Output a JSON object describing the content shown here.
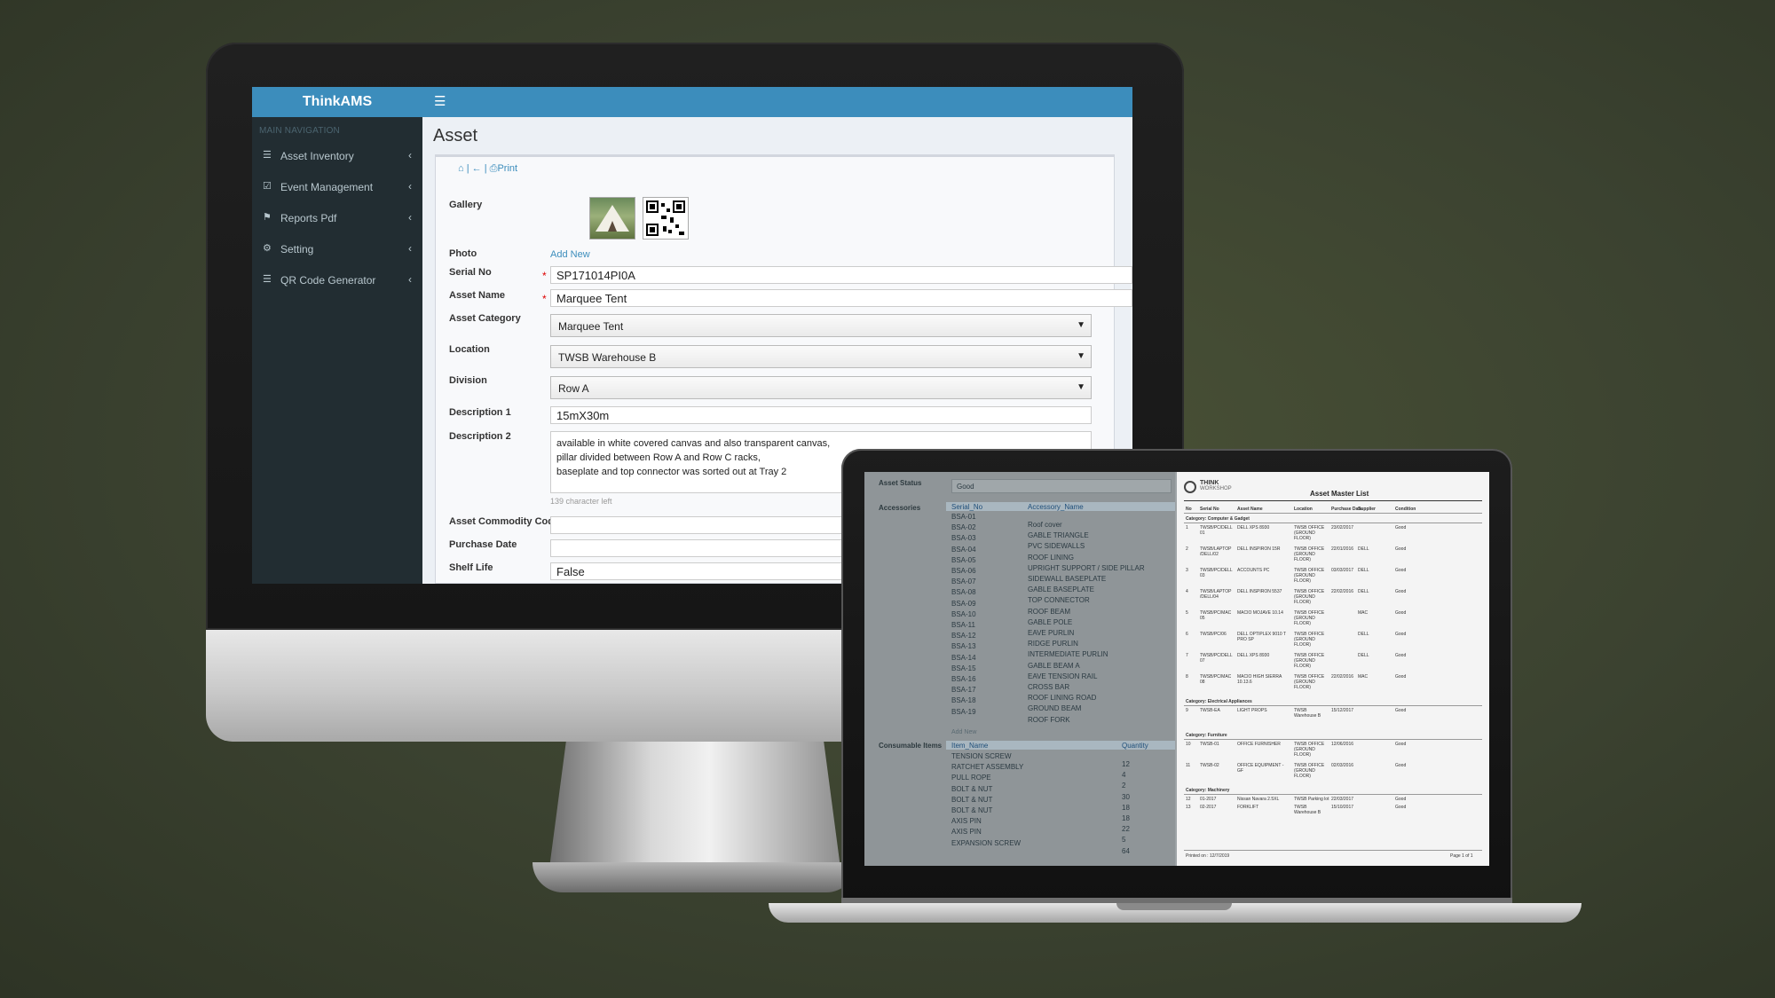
{
  "app": {
    "brand": "ThinkAMS",
    "menu_icon": "hamburger-icon"
  },
  "sidebar": {
    "header": "MAIN NAVIGATION",
    "items": [
      {
        "label": "Asset Inventory",
        "icon": "list-icon"
      },
      {
        "label": "Event Management",
        "icon": "check-square-icon"
      },
      {
        "label": "Reports Pdf",
        "icon": "flag-icon"
      },
      {
        "label": "Setting",
        "icon": "gears-icon"
      },
      {
        "label": "QR Code Generator",
        "icon": "list-icon"
      }
    ]
  },
  "asset_form": {
    "title": "Asset",
    "toolbar": {
      "print": "Print"
    },
    "labels": {
      "gallery": "Gallery",
      "photo": "Photo",
      "serial": "Serial No",
      "name": "Asset Name",
      "category": "Asset Category",
      "location": "Location",
      "division": "Division",
      "desc1": "Description 1",
      "desc2": "Description 2",
      "commodity": "Asset Commodity Code",
      "purchase": "Purchase Date",
      "shelf": "Shelf Life"
    },
    "add_new": "Add New",
    "values": {
      "serial": "SP171014PI0A",
      "name": "Marquee Tent",
      "category": "Marquee Tent",
      "location": "TWSB Warehouse B",
      "division": "Row A",
      "desc1": "15mX30m",
      "desc2_lines": [
        "available in white covered canvas and also transparent canvas,",
        "pillar divided between Row A and Row C racks,",
        "baseplate and top connector was sorted out at Tray 2"
      ],
      "char_left": "139 character left",
      "shelf": "False"
    }
  },
  "laptop": {
    "asset_status_label": "Asset Status",
    "asset_status_value": "Good",
    "accessories_label": "Accessories",
    "acc_headers": [
      "Serial_No",
      "Accessory_Name"
    ],
    "accessories": [
      [
        "BSA-01",
        "Roof cover"
      ],
      [
        "BSA-02",
        "GABLE TRIANGLE"
      ],
      [
        "BSA-03",
        "PVC SIDEWALLS"
      ],
      [
        "BSA-04",
        "ROOF LINING"
      ],
      [
        "BSA-05",
        "UPRIGHT SUPPORT / SIDE PILLAR"
      ],
      [
        "BSA-06",
        "SIDEWALL BASEPLATE"
      ],
      [
        "BSA-07",
        "GABLE BASEPLATE"
      ],
      [
        "BSA-08",
        "TOP CONNECTOR"
      ],
      [
        "BSA-09",
        "ROOF BEAM"
      ],
      [
        "BSA-10",
        "GABLE POLE"
      ],
      [
        "BSA-11",
        "EAVE PURLIN"
      ],
      [
        "BSA-12",
        "RIDGE PURLIN"
      ],
      [
        "BSA-13",
        "INTERMEDIATE PURLIN"
      ],
      [
        "BSA-14",
        "GABLE BEAM A"
      ],
      [
        "BSA-15",
        "EAVE TENSION RAIL"
      ],
      [
        "BSA-16",
        "CROSS BAR"
      ],
      [
        "BSA-17",
        "ROOF LINING ROAD"
      ],
      [
        "BSA-18",
        "GROUND BEAM"
      ],
      [
        "BSA-19",
        "ROOF FORK"
      ]
    ],
    "acc_add_new": "Add New",
    "consumables_label": "Consumable Items",
    "cons_headers": [
      "Item_Name",
      "Quantity"
    ],
    "consumables": [
      [
        "TENSION SCREW",
        "12"
      ],
      [
        "RATCHET ASSEMBLY",
        "4"
      ],
      [
        "PULL ROPE",
        "2"
      ],
      [
        "BOLT & NUT",
        "30"
      ],
      [
        "BOLT & NUT",
        "18"
      ],
      [
        "BOLT & NUT",
        "18"
      ],
      [
        "AXIS PIN",
        "22"
      ],
      [
        "AXIS PIN",
        "5"
      ],
      [
        "EXPANSION SCREW",
        "64"
      ]
    ],
    "report": {
      "logo_top": "THINK",
      "logo_bottom": "WORKSHOP",
      "title": "Asset Master List",
      "headers": [
        "No",
        "Serial No",
        "Asset Name",
        "Location",
        "Purchase Date",
        "Supplier",
        "Condition"
      ],
      "cat1": "Category: Computer & Gadget",
      "cat2": "Category: Electrical Appliances",
      "cat3": "Category: Furniture",
      "cat4": "Category: Machinery",
      "rows1": [
        [
          "1",
          "TWSB/PC/DELL 01",
          "DELL XPS 8930",
          "TWSB OFFICE (GROUND FLOOR)",
          "23/02/2017",
          "",
          "Good"
        ],
        [
          "2",
          "TWSB/LAPTOP /DELL/02",
          "DELL INSPIRON 15R",
          "TWSB OFFICE (GROUND FLOOR)",
          "22/01/2016",
          "DELL",
          "Good"
        ],
        [
          "3",
          "TWSB/PC/DELL 03",
          "ACCOUNTS PC",
          "TWSB OFFICE (GROUND FLOOR)",
          "03/03/2017",
          "DELL",
          "Good"
        ],
        [
          "4",
          "TWSB/LAPTOP /DELL/04",
          "DELL INSPIRON 5537",
          "TWSB OFFICE (GROUND FLOOR)",
          "22/02/2016",
          "DELL",
          "Good"
        ],
        [
          "5",
          "TWSB/PC/MAC 05",
          "MACIO MOJAVE 10.14",
          "TWSB OFFICE (GROUND FLOOR)",
          "",
          "MAC",
          "Good"
        ],
        [
          "6",
          "TWSB/PC/06",
          "DELL OPTIPLEX 9010 T PRO SP",
          "TWSB OFFICE (GROUND FLOOR)",
          "",
          "DELL",
          "Good"
        ],
        [
          "7",
          "TWSB/PC/DELL 07",
          "DELL XPS 8930",
          "TWSB OFFICE (GROUND FLOOR)",
          "",
          "DELL",
          "Good"
        ],
        [
          "8",
          "TWSB/PC/MAC 08",
          "MACIO HIGH SIERRA 10.13.6",
          "TWSB OFFICE (GROUND FLOOR)",
          "22/02/2016",
          "MAC",
          "Good"
        ]
      ],
      "rows2": [
        [
          "9",
          "TWSB-EA",
          "LIGHT PROPS",
          "TWSB Warehouse B",
          "15/12/2017",
          "",
          "Good"
        ]
      ],
      "rows3": [
        [
          "10",
          "TWSB-01",
          "OFFICE FURNISHER",
          "TWSB OFFICE (GROUND FLOOR)",
          "12/06/2016",
          "",
          "Good"
        ],
        [
          "11",
          "TWSB-02",
          "OFFICE EQUIPMENT - GF",
          "TWSB OFFICE (GROUND FLOOR)",
          "02/03/2016",
          "",
          "Good"
        ]
      ],
      "rows4": [
        [
          "12",
          "01-2017",
          "Nissan Navara 2.5XL",
          "TWSB Parking lot",
          "22/03/2017",
          "",
          "Good"
        ],
        [
          "13",
          "02-2017",
          "FORKLIFT",
          "TWSB Warehouse B",
          "15/10/2017",
          "",
          "Good"
        ]
      ],
      "footer_left": "Printed on : 12/7/2019",
      "footer_right": "Page 1 of 1"
    }
  }
}
